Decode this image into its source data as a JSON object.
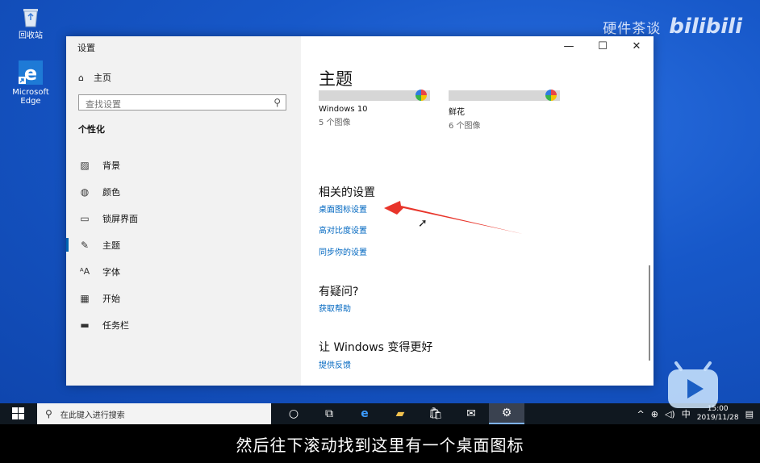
{
  "desktop": {
    "icons": [
      {
        "label": "回收站",
        "icon": "recycle-bin-icon"
      },
      {
        "label": "Microsoft Edge",
        "icon": "edge-icon"
      }
    ],
    "watermark": {
      "text": "硬件茶谈",
      "logo": "bilibili"
    }
  },
  "window": {
    "title": "设置",
    "controls": {
      "minimize": "—",
      "maximize": "☐",
      "close": "✕"
    },
    "sidebar": {
      "home_label": "主页",
      "search_placeholder": "查找设置",
      "section_title": "个性化",
      "items": [
        {
          "label": "背景",
          "icon": "picture-icon",
          "active": false
        },
        {
          "label": "颜色",
          "icon": "palette-icon",
          "active": false
        },
        {
          "label": "锁屏界面",
          "icon": "lockscreen-icon",
          "active": false
        },
        {
          "label": "主题",
          "icon": "theme-brush-icon",
          "active": true
        },
        {
          "label": "字体",
          "icon": "font-icon",
          "active": false
        },
        {
          "label": "开始",
          "icon": "start-grid-icon",
          "active": false
        },
        {
          "label": "任务栏",
          "icon": "taskbar-icon",
          "active": false
        }
      ]
    },
    "main": {
      "title": "主题",
      "themes": [
        {
          "name": "Windows 10",
          "count": "5 个图像"
        },
        {
          "name": "鲜花",
          "count": "6 个图像"
        }
      ],
      "related": {
        "heading": "相关的设置",
        "links": [
          "桌面图标设置",
          "高对比度设置",
          "同步你的设置"
        ]
      },
      "help": {
        "heading": "有疑问?",
        "link": "获取帮助"
      },
      "improve": {
        "heading": "让 Windows 变得更好",
        "link": "提供反馈"
      }
    }
  },
  "taskbar": {
    "search_placeholder": "在此键入进行搜索",
    "ime": "中",
    "time": "15:00",
    "date": "2019/11/28"
  },
  "subtitle": "然后往下滚动找到这里有一个桌面图标",
  "colors": {
    "accent": "#0063b1",
    "link": "#0067c0",
    "arrow": "#e8342a",
    "taskbar": "#101820"
  }
}
